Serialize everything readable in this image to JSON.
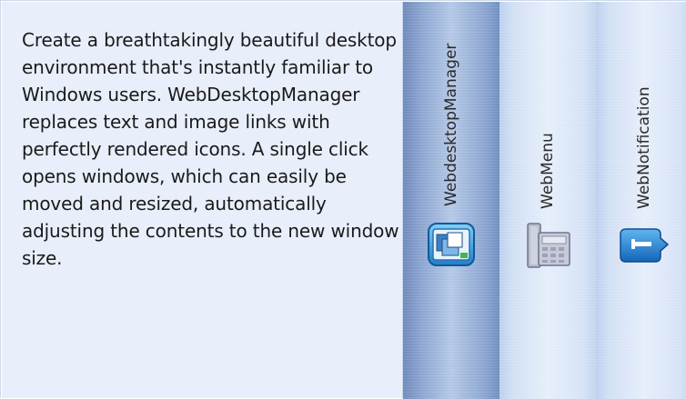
{
  "description": "Create a breathtakingly beautiful desktop environment that's instantly familiar to Windows users. WebDesktopManager replaces text and image links with perfectly rendered icons. A single click opens windows, which can easily be moved and resized, automatically adjusting the contents to the new window size.",
  "tabs": [
    {
      "label": "WebdesktopManager",
      "icon": "desktop-windows-icon",
      "active": true
    },
    {
      "label": "WebMenu",
      "icon": "menu-phone-icon",
      "active": false
    },
    {
      "label": "WebNotification",
      "icon": "notification-balloon-icon",
      "active": false
    }
  ],
  "colors": {
    "content_bg": "#e8effa",
    "active_tab": "#8aa4cf",
    "inactive_tab": "#dbe6f7",
    "text": "#1a1a1a"
  }
}
